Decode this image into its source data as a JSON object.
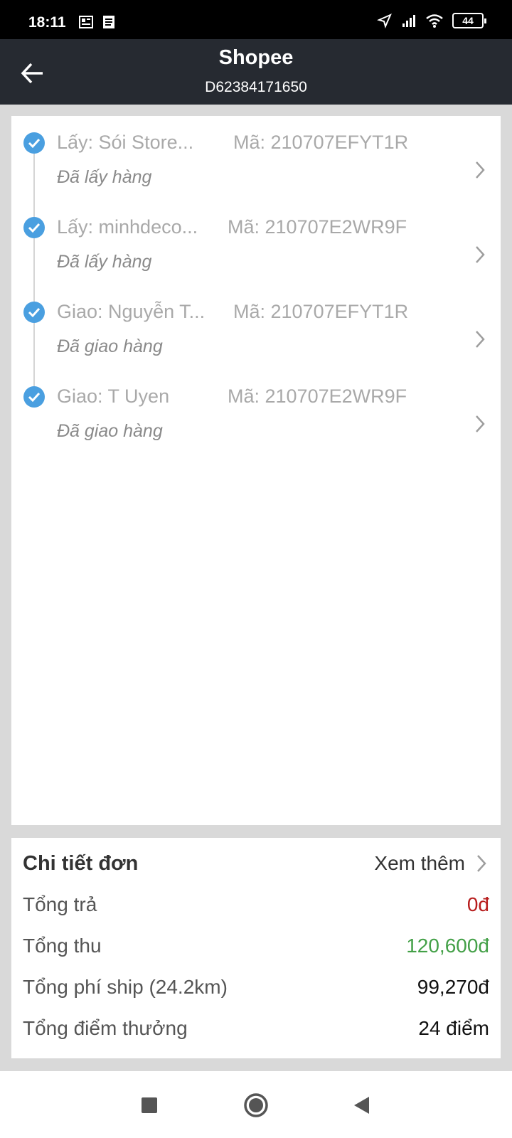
{
  "status_bar": {
    "time": "18:11",
    "battery": "44"
  },
  "header": {
    "title": "Shopee",
    "order_id": "D62384171650"
  },
  "stops": [
    {
      "name": "Lấy: Sói Store...",
      "code": "Mã: 210707EFYT1R",
      "status": "Đã lấy hàng"
    },
    {
      "name": "Lấy: minhdeco...",
      "code": "Mã: 210707E2WR9F",
      "status": "Đã lấy hàng"
    },
    {
      "name": "Giao: Nguyễn T...",
      "code": "Mã: 210707EFYT1R",
      "status": "Đã giao hàng"
    },
    {
      "name": "Giao: T Uyen",
      "code": "Mã: 210707E2WR9F",
      "status": "Đã giao hàng"
    }
  ],
  "details": {
    "title": "Chi tiết đơn",
    "more_label": "Xem thêm",
    "rows": [
      {
        "label": "Tổng trả",
        "value": "0đ",
        "color": "#b71c1c"
      },
      {
        "label": "Tổng thu",
        "value": "120,600đ",
        "color": "#43a047"
      },
      {
        "label": "Tổng phí ship (24.2km)",
        "value": "99,270đ",
        "color": "#111111"
      },
      {
        "label": "Tổng điểm thưởng",
        "value": "24 điểm",
        "color": "#111111"
      }
    ]
  },
  "colors": {
    "header_bg": "#262a31",
    "check_blue": "#4a9fe0"
  }
}
